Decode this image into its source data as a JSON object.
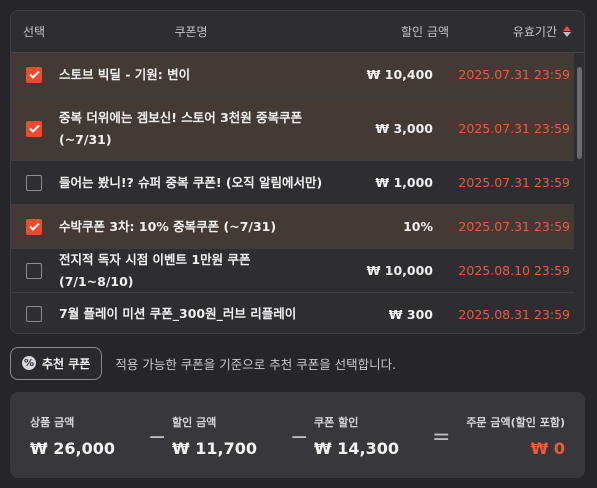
{
  "table": {
    "headers": {
      "select": "선택",
      "name": "쿠폰명",
      "amount": "할인 금액",
      "expiry": "유효기간"
    },
    "rows": [
      {
        "checked": true,
        "name": "스토브 빅딜 - 기원: 변이",
        "amount": "₩ 10,400",
        "expiry": "2025.07.31 23:59"
      },
      {
        "checked": true,
        "name": "중복 더위에는 겜보신! 스토어 3천원 중복쿠폰 (~7/31)",
        "amount": "₩ 3,000",
        "expiry": "2025.07.31 23:59"
      },
      {
        "checked": false,
        "name": "들어는 봤니!? 슈퍼 중복 쿠폰! (오직 알림에서만)",
        "amount": "₩ 1,000",
        "expiry": "2025.07.31 23:59"
      },
      {
        "checked": true,
        "name": "수박쿠폰 3차: 10% 중복쿠폰 (~7/31)",
        "amount": "10%",
        "expiry": "2025.07.31 23:59"
      },
      {
        "checked": false,
        "name": "전지적 독자 시점 이벤트 1만원 쿠폰 (7/1~8/10)",
        "amount": "₩ 10,000",
        "expiry": "2025.08.10 23:59"
      },
      {
        "checked": false,
        "name": "7월 플레이 미션 쿠폰_300원_러브 리플레이",
        "amount": "₩ 300",
        "expiry": "2025.08.31 23:59"
      }
    ]
  },
  "recommend": {
    "button_label": "추천 쿠폰",
    "description": "적용 가능한 쿠폰을 기준으로 추천 쿠폰을 선택합니다."
  },
  "summary": {
    "product_label": "상품 금액",
    "product_value": "₩ 26,000",
    "discount_label": "할인 금액",
    "discount_value": "₩ 11,700",
    "coupon_label": "쿠폰 할인",
    "coupon_value": "₩ 14,300",
    "order_label": "주문 금액(할인 포함)",
    "order_value": "₩ 0",
    "op_minus": "−",
    "op_equals": "="
  },
  "colors": {
    "accent": "#ef4a2e",
    "expiry": "#ef5a3c",
    "checked_row": "#443a35",
    "background": "#26262a"
  }
}
